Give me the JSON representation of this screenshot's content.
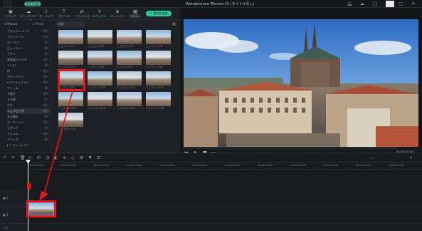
{
  "window": {
    "export_label": "エクスポート",
    "title": "Wondershare Filmora 11 (タイトルなし)",
    "back_glyph": "‹",
    "icons": [
      "bell-icon",
      "cloud-icon",
      "user-icon",
      "minimize-icon",
      "maximize-icon",
      "close-icon"
    ]
  },
  "tabs": [
    {
      "label": "メディア",
      "icon": "▣"
    },
    {
      "label": "ストックメディア",
      "icon": "☁"
    },
    {
      "label": "オーディオ",
      "icon": "♪"
    },
    {
      "label": "タイトル",
      "icon": "T"
    },
    {
      "label": "トランジション",
      "icon": "⇄"
    },
    {
      "label": "エフェクト",
      "icon": "✦"
    },
    {
      "label": "エレメント",
      "icon": "◈"
    },
    {
      "label": "分割表示",
      "icon": "▦"
    }
  ],
  "add_button": "+ 素材を追加",
  "left_panel": {
    "head_a": "▾ Filmora",
    "head_b": "▸ Preset",
    "categories": [
      {
        "label": "ブラッシュメイク",
        "count": "(11)"
      },
      {
        "label": "ヴィンテージ",
        "count": "(31)"
      },
      {
        "label": "モノクロ",
        "count": "(5)"
      },
      {
        "label": "ビューティー",
        "count": "(8)"
      },
      {
        "label": "ブラー",
        "count": "(6)"
      },
      {
        "label": "映画風フィルタ",
        "count": "(12)"
      },
      {
        "label": "レトロ",
        "count": "(9)"
      },
      {
        "label": "AI",
        "count": "(14)"
      },
      {
        "label": "ネオンライト",
        "count": "(20)"
      },
      {
        "label": "▾ ユーティリティ",
        "count": "(16)"
      },
      {
        "label": "フレーム",
        "count": "(8)"
      },
      {
        "label": "手描き",
        "count": "(10)"
      },
      {
        "label": "その他",
        "count": "(7)"
      },
      {
        "label": "ボケ",
        "count": "(12)"
      },
      {
        "label": "シェアビング",
        "count": "(18)"
      },
      {
        "label": "光の漏れ",
        "count": "(9)"
      },
      {
        "label": "オーバーレイ",
        "count": "(11)"
      },
      {
        "label": "モザイク",
        "count": "(6)"
      },
      {
        "label": "フィルム",
        "count": "(13)"
      },
      {
        "label": "グリッチ",
        "count": "(8)"
      },
      {
        "label": "▸ トランジション",
        "count": ""
      }
    ],
    "selected_index": 14
  },
  "grid": {
    "search_placeholder": "検索",
    "labels": [
      "シェアビング1",
      "シェアビング2",
      "シェアビング3",
      "シェアビング4",
      "シェアビング5",
      "シェアビング6",
      "シェアビング7",
      "シェアビング8",
      "シェアビング9",
      "シェアビング10",
      "シェアビング11",
      "シェアビング12",
      "シェアビング13",
      "シェアビング14",
      "シェアビング15",
      "シェアビング16",
      "シェアビング17"
    ]
  },
  "player": {
    "timecode": "00:00:00:00",
    "play_glyph": "▶",
    "stop_glyph": "■",
    "prev_glyph": "⏮",
    "next_glyph": "⏭"
  },
  "timeline": {
    "ticks": [
      "00:00:00:00",
      "00:00:05:00",
      "00:00:10:00",
      "00:00:15:00",
      "00:00:20:00",
      "00:00:25:00",
      "00:00:30:00",
      "00:00:35:00",
      "00:00:40:00",
      "00:00:45:00",
      "00:00:50:00",
      "00:00:55:00"
    ],
    "track_labels": [
      "▣ 2",
      "▣ 1",
      "♪ 1"
    ]
  },
  "colors": {
    "accent": "#2fd2b2",
    "highlight": "#e0181b"
  }
}
